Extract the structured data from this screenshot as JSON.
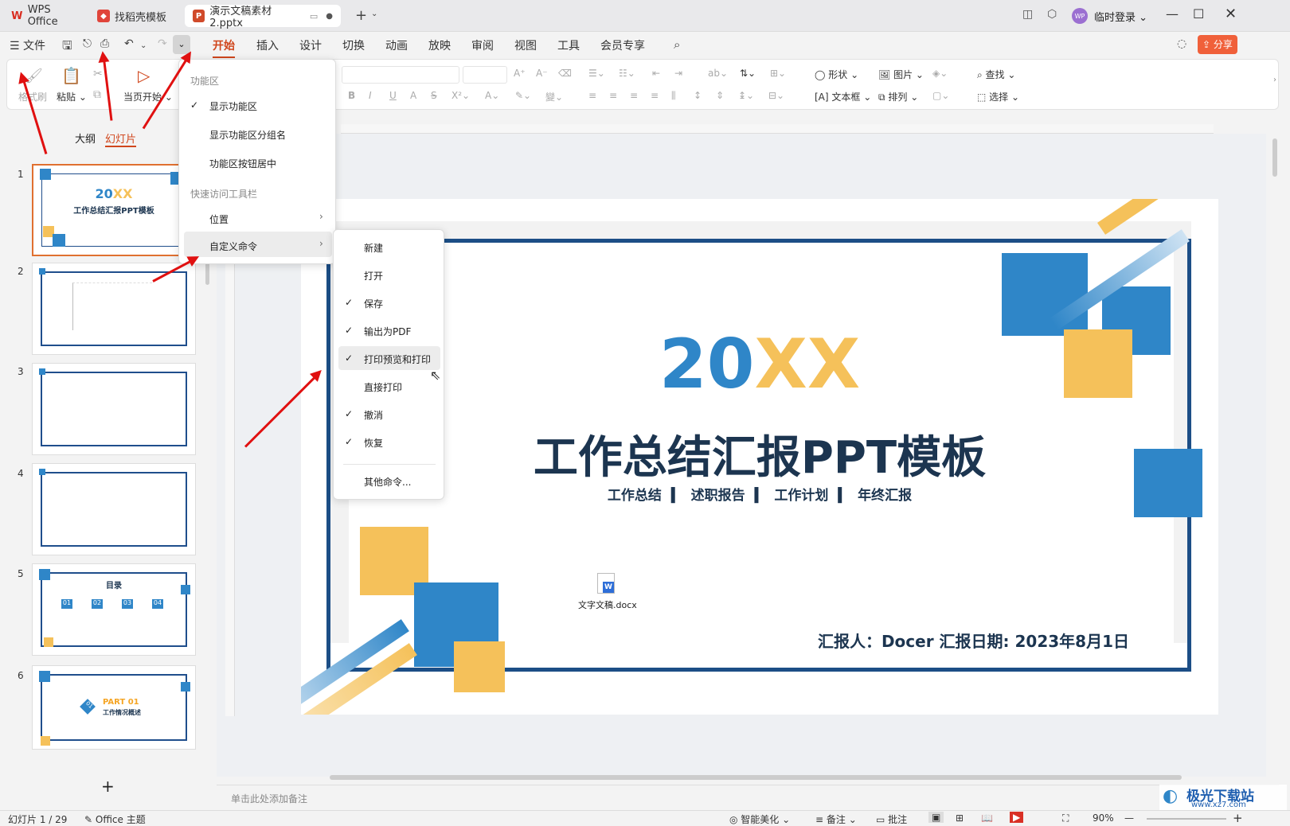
{
  "titlebar": {
    "tabs": [
      {
        "label": "WPS Office"
      },
      {
        "label": "找稻壳模板"
      },
      {
        "label": "演示文稿素材2.pptx"
      }
    ],
    "user": "临时登录",
    "avatar": "WP"
  },
  "menubar": {
    "file": "文件",
    "items": [
      "开始",
      "插入",
      "设计",
      "切换",
      "动画",
      "放映",
      "审阅",
      "视图",
      "工具",
      "会员专享"
    ],
    "share": "分享"
  },
  "ribbon": {
    "format_painter": "格式刷",
    "paste": "粘贴",
    "start_current": "当页开始",
    "shape": "形状",
    "picture": "图片",
    "textbox": "文本框",
    "arrange": "排列",
    "find": "查找",
    "select": "选择"
  },
  "sidebar": {
    "outline_tab": "大纲",
    "slides_tab": "幻灯片",
    "slide_numbers": [
      "1",
      "2",
      "3",
      "4",
      "5",
      "6"
    ],
    "thumb1": {
      "title_a": "20",
      "title_b": "XX",
      "subtitle": "工作总结汇报PPT模板"
    },
    "thumb5": {
      "title": "目录",
      "items": [
        "01",
        "02",
        "03",
        "04"
      ]
    },
    "thumb6": {
      "part": "PART 01",
      "sub": "工作情况概述",
      "num": "01"
    }
  },
  "dropdown": {
    "section1": "功能区",
    "show_ribbon": "显示功能区",
    "show_group_names": "显示功能区分组名",
    "center_buttons": "功能区按钮居中",
    "section2": "快速访问工具栏",
    "position": "位置",
    "custom": "自定义命令"
  },
  "submenu": {
    "items": [
      {
        "label": "新建",
        "checked": false
      },
      {
        "label": "打开",
        "checked": false
      },
      {
        "label": "保存",
        "checked": true
      },
      {
        "label": "输出为PDF",
        "checked": true
      },
      {
        "label": "打印预览和打印",
        "checked": true
      },
      {
        "label": "直接打印",
        "checked": false
      },
      {
        "label": "撤消",
        "checked": true
      },
      {
        "label": "恢复",
        "checked": true
      }
    ],
    "more": "其他命令..."
  },
  "slide": {
    "year_a": "20",
    "year_b": "XX",
    "title": "工作总结汇报PPT模板",
    "subtitles": [
      "工作总结",
      "述职报告",
      "工作计划",
      "年终汇报"
    ],
    "reporter": "汇报人：Docer  汇报日期: 2023年8月1日",
    "file_label": "文字文稿.docx"
  },
  "notes_placeholder": "单击此处添加备注",
  "statusbar": {
    "slide_count": "幻灯片 1 / 29",
    "theme": "Office 主题",
    "beautify": "智能美化",
    "notes": "备注",
    "comments": "批注",
    "zoom": "90%"
  },
  "watermark": {
    "site": "极光下载站",
    "url": "www.xz7.com"
  },
  "colors": {
    "accent": "#d0461c",
    "blue": "#2f86c8",
    "yellow": "#f5c15a",
    "navy": "#1c3550"
  }
}
